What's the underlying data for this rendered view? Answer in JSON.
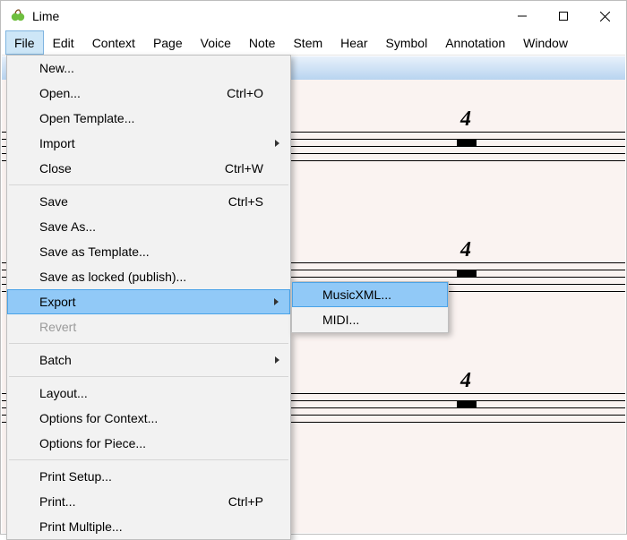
{
  "app": {
    "title": "Lime"
  },
  "menubar": {
    "items": [
      "File",
      "Edit",
      "Context",
      "Page",
      "Voice",
      "Note",
      "Stem",
      "Hear",
      "Symbol",
      "Annotation",
      "Window"
    ],
    "active_index": 0
  },
  "file_menu": {
    "groups": [
      [
        {
          "label": "New...",
          "shortcut": "",
          "submenu": false,
          "disabled": false
        },
        {
          "label": "Open...",
          "shortcut": "Ctrl+O",
          "submenu": false,
          "disabled": false
        },
        {
          "label": "Open Template...",
          "shortcut": "",
          "submenu": false,
          "disabled": false
        },
        {
          "label": "Import",
          "shortcut": "",
          "submenu": true,
          "disabled": false
        },
        {
          "label": "Close",
          "shortcut": "Ctrl+W",
          "submenu": false,
          "disabled": false
        }
      ],
      [
        {
          "label": "Save",
          "shortcut": "Ctrl+S",
          "submenu": false,
          "disabled": false
        },
        {
          "label": "Save As...",
          "shortcut": "",
          "submenu": false,
          "disabled": false
        },
        {
          "label": "Save as Template...",
          "shortcut": "",
          "submenu": false,
          "disabled": false
        },
        {
          "label": "Save as locked (publish)...",
          "shortcut": "",
          "submenu": false,
          "disabled": false
        },
        {
          "label": "Export",
          "shortcut": "",
          "submenu": true,
          "disabled": false,
          "highlight": true
        },
        {
          "label": "Revert",
          "shortcut": "",
          "submenu": false,
          "disabled": true
        }
      ],
      [
        {
          "label": "Batch",
          "shortcut": "",
          "submenu": true,
          "disabled": false
        }
      ],
      [
        {
          "label": "Layout...",
          "shortcut": "",
          "submenu": false,
          "disabled": false
        },
        {
          "label": "Options for Context...",
          "shortcut": "",
          "submenu": false,
          "disabled": false
        },
        {
          "label": "Options for Piece...",
          "shortcut": "",
          "submenu": false,
          "disabled": false
        }
      ],
      [
        {
          "label": "Print Setup...",
          "shortcut": "",
          "submenu": false,
          "disabled": false
        },
        {
          "label": "Print...",
          "shortcut": "Ctrl+P",
          "submenu": false,
          "disabled": false
        },
        {
          "label": "Print Multiple...",
          "shortcut": "",
          "submenu": false,
          "disabled": false
        }
      ]
    ]
  },
  "export_menu": {
    "items": [
      {
        "label": "MusicXML...",
        "highlight": true
      },
      {
        "label": "MIDI...",
        "highlight": false
      }
    ]
  },
  "score": {
    "rest_marker": "4"
  }
}
